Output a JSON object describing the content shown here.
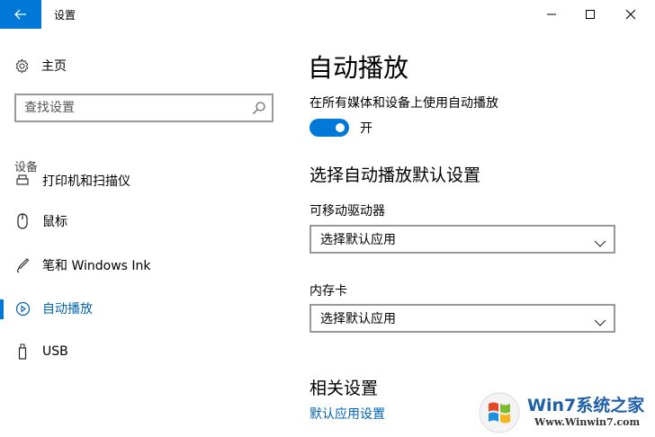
{
  "window": {
    "title": "设置"
  },
  "nav": {
    "home_label": "主页",
    "search_placeholder": "查找设置",
    "section_title": "设备",
    "items": [
      {
        "label": "打印机和扫描仪",
        "icon": "printer-icon"
      },
      {
        "label": "鼠标",
        "icon": "mouse-icon"
      },
      {
        "label": "笔和 Windows Ink",
        "icon": "pen-icon"
      },
      {
        "label": "自动播放",
        "icon": "autoplay-icon",
        "selected": true
      },
      {
        "label": "USB",
        "icon": "usb-icon"
      }
    ]
  },
  "main": {
    "title": "自动播放",
    "toggle_description": "在所有媒体和设备上使用自动播放",
    "toggle_state": "开",
    "toggle_on": true,
    "defaults_heading": "选择自动播放默认设置",
    "removable_label": "可移动驱动器",
    "removable_value": "选择默认应用",
    "memory_card_label": "内存卡",
    "memory_card_value": "选择默认应用",
    "related_heading": "相关设置",
    "related_link": "默认应用设置"
  },
  "watermark": {
    "title": "Win7系统之家",
    "url": "Www.Winwin7.com"
  },
  "colors": {
    "accent": "#0078d7",
    "link": "#0063b1"
  }
}
